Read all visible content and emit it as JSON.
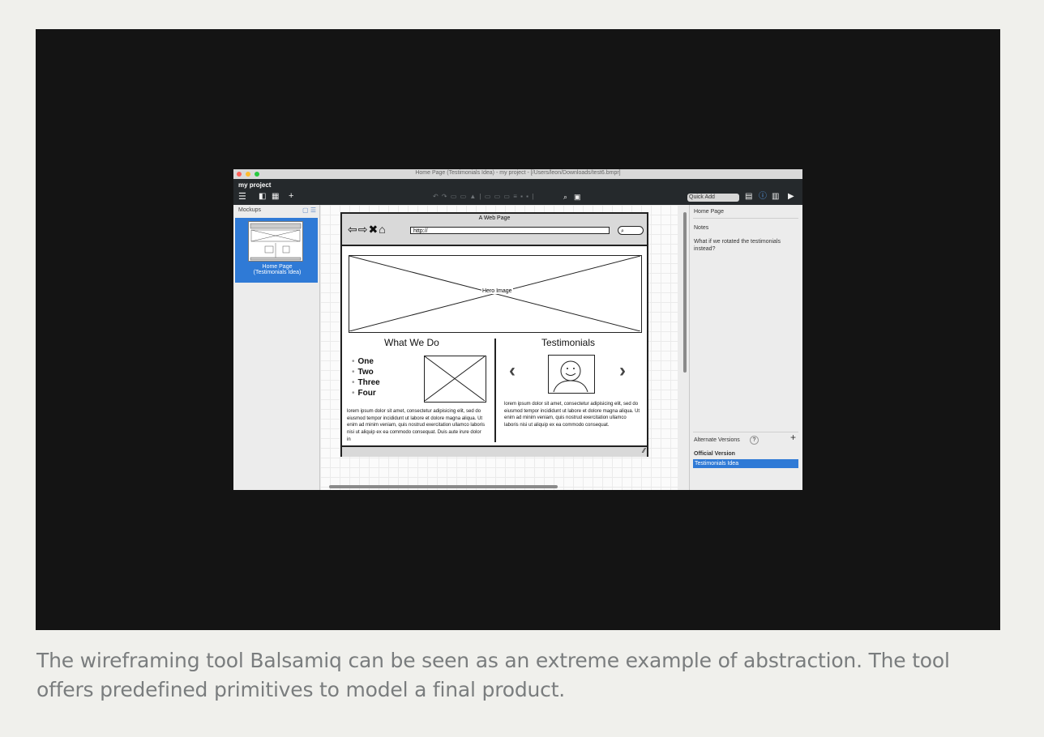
{
  "caption": "The wireframing tool Balsamiq can be seen as an extreme example of abstraction. The tool offers predefined primitives to model a final product.",
  "window": {
    "title": "Home Page (Testimonials Idea) - my project - [/Users/leon/Downloads/test6.bmpr]",
    "project_name": "my project",
    "quick_add_placeholder": "Quick Add"
  },
  "left_panel": {
    "heading": "Mockups",
    "mockup_label_line1": "Home Page",
    "mockup_label_line2": "(Testimonials Idea)"
  },
  "mockup": {
    "browser_title": "A Web Page",
    "url": "http://",
    "hero_label": "Hero Image",
    "what_we_do_heading": "What We Do",
    "testimonials_heading": "Testimonials",
    "bullets": [
      "One",
      "Two",
      "Three",
      "Four"
    ],
    "lorem_left": "lorem ipsum dolor sit amet, consectetur adipisicing elit, sed do eiusmod tempor incididunt ut labore et dolore magna aliqua. Ut enim ad minim veniam, quis nostrud exercitation ullamco laboris nisi ut aliquip ex ea commodo consequat. Duis aute irure dolor in",
    "lorem_right": "lorem ipsum dolor sit amet, consectetur adipisicing elit, sed do eiusmod tempor incididunt ut labore et dolore magna aliqua. Ut enim ad minim veniam, quis nostrud exercitation ullamco laboris nisi ut aliquip ex ea commodo consequat."
  },
  "right_panel": {
    "page_name": "Home Page",
    "notes_label": "Notes",
    "notes_text": "What if we rotated the testimonials instead?",
    "alt_versions_label": "Alternate Versions",
    "official_version": "Official Version",
    "selected_version": "Testimonials Idea"
  },
  "colors": {
    "selection_blue": "#2f7ad6",
    "toolbar_dark": "#25292c",
    "page_background": "#f0f0ec"
  }
}
